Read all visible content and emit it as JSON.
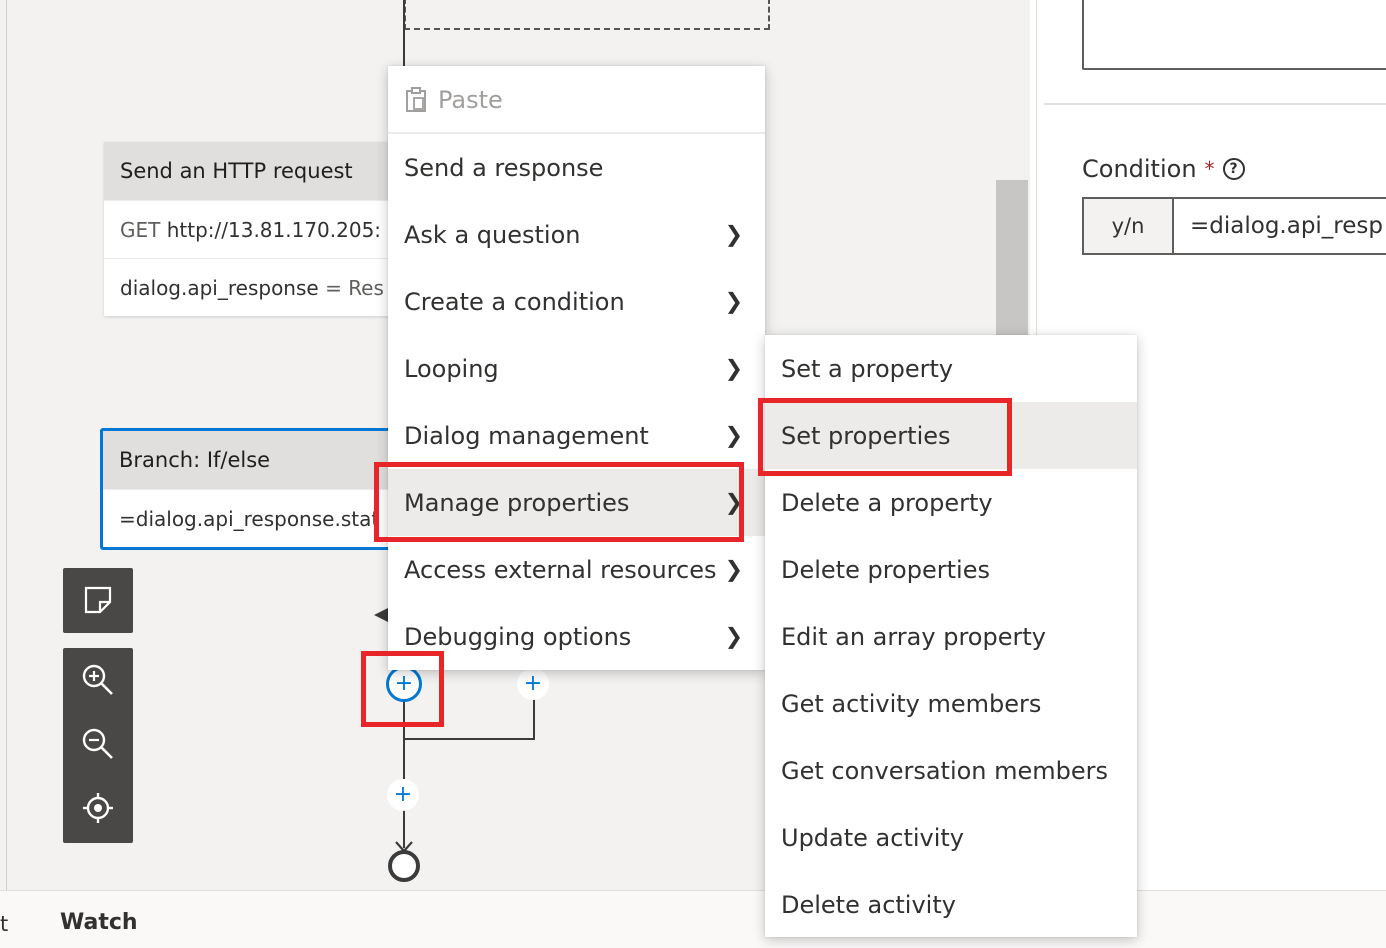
{
  "canvas": {
    "http_card": {
      "title": "Send an HTTP request",
      "method": "GET",
      "url": "http://13.81.170.205:",
      "result_var": "dialog.api_response",
      "result_eq": "=",
      "result_val": "Res"
    },
    "branch_card": {
      "title": "Branch: If/else",
      "condition": "=dialog.api_response.stat"
    },
    "toolbar": {
      "minimap_icon": "minimap-icon",
      "zoom_in_icon": "zoom-in-icon",
      "zoom_out_icon": "zoom-out-icon",
      "fit_icon": "fit-to-view-icon"
    },
    "plus_symbol": "+"
  },
  "context_menu": {
    "paste_label": "Paste",
    "items": [
      {
        "label": "Send a response",
        "submenu": false
      },
      {
        "label": "Ask a question",
        "submenu": true
      },
      {
        "label": "Create a condition",
        "submenu": true
      },
      {
        "label": "Looping",
        "submenu": true
      },
      {
        "label": "Dialog management",
        "submenu": true
      },
      {
        "label": "Manage properties",
        "submenu": true,
        "highlighted": true
      },
      {
        "label": "Access external resources",
        "submenu": true
      },
      {
        "label": "Debugging options",
        "submenu": true
      }
    ]
  },
  "submenu": {
    "items": [
      {
        "label": "Set a property"
      },
      {
        "label": "Set properties",
        "highlighted": true
      },
      {
        "label": "Delete a property"
      },
      {
        "label": "Delete properties"
      },
      {
        "label": "Edit an array property"
      },
      {
        "label": "Get activity members"
      },
      {
        "label": "Get conversation members"
      },
      {
        "label": "Update activity"
      },
      {
        "label": "Delete activity"
      }
    ]
  },
  "properties_panel": {
    "condition_label": "Condition",
    "required_mark": "*",
    "help_symbol": "?",
    "type_prefix": "y/n",
    "condition_value": "=dialog.api_resp"
  },
  "bottom_bar": {
    "partial_tab": "t",
    "watch_tab": "Watch"
  },
  "colors": {
    "accent": "#0078d4",
    "highlight": "#e8262a",
    "toolbar_bg": "#4a4847"
  }
}
